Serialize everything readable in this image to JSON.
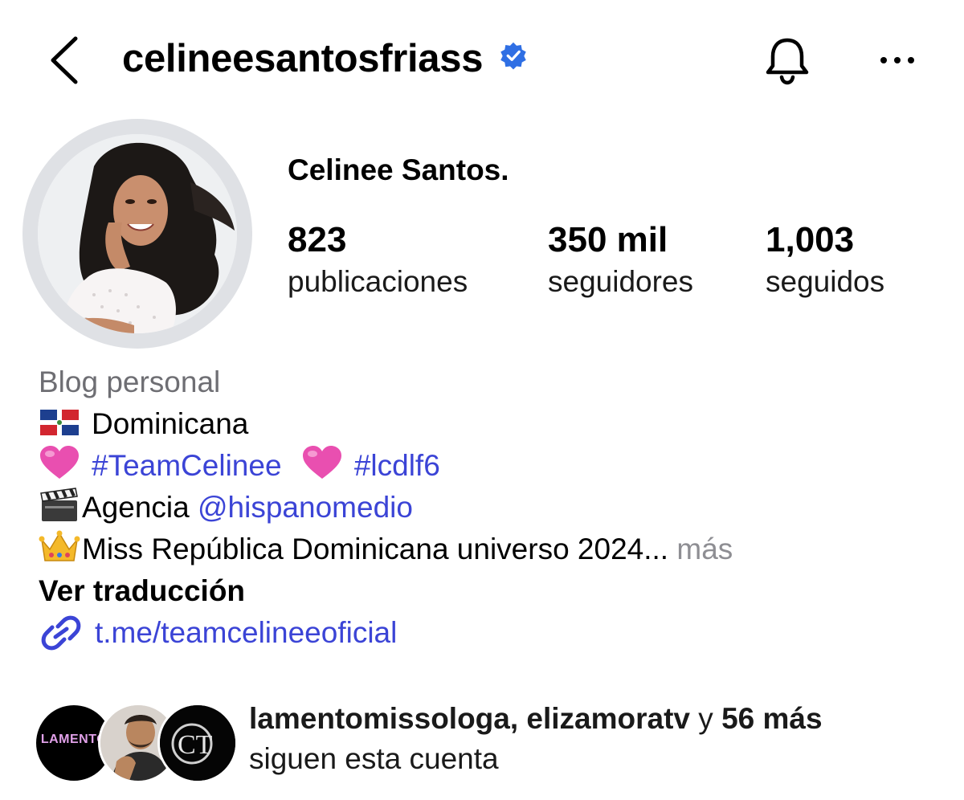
{
  "header": {
    "username": "celineesantosfriass",
    "back_icon": "chevron-left-icon",
    "verified_icon": "verified-badge-icon",
    "bell_icon": "bell-icon",
    "more_icon": "more-dots-icon"
  },
  "profile": {
    "full_name": "Celinee Santos.",
    "stats": [
      {
        "value": "823",
        "label": "publicaciones"
      },
      {
        "value": "350 mil",
        "label": "seguidores"
      },
      {
        "value": "1,003",
        "label": "seguidos"
      }
    ]
  },
  "bio": {
    "category": "Blog personal",
    "nationality": "Dominicana",
    "hashtag_1": "#TeamCelinee",
    "hashtag_2": "#lcdlf6",
    "agency_label": "Agencia ",
    "agency_handle": "@hispanomedio",
    "title_line": "Miss República Dominicana universo 2024...",
    "more": "más",
    "translate": "Ver traducción",
    "link": "t.me/teamcelineeoficial"
  },
  "followed_by": {
    "avatar_1_text": "LAMENTO",
    "names": "lamentomissologa, elizamoratv",
    "connector": " y ",
    "count": "56 más",
    "caption": "siguen esta cuenta"
  },
  "colors": {
    "link_blue": "#3b44d6",
    "verified_blue": "#2f6fe4",
    "muted_gray": "#6e6e73"
  }
}
